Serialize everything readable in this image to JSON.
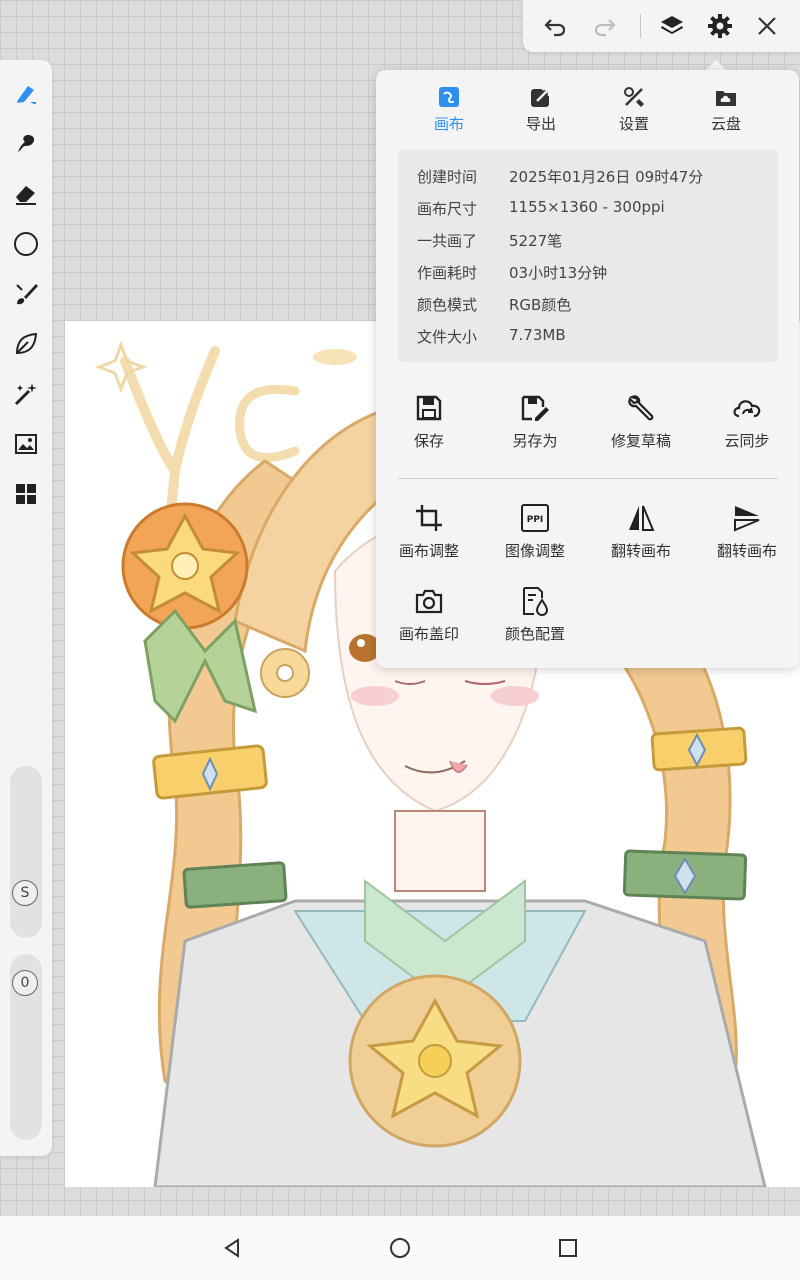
{
  "popup": {
    "tabs": [
      {
        "label": "画布",
        "icon": "canvas-icon",
        "active": true
      },
      {
        "label": "导出",
        "icon": "export-icon",
        "active": false
      },
      {
        "label": "设置",
        "icon": "settings-tools-icon",
        "active": false
      },
      {
        "label": "云盘",
        "icon": "cloud-drive-icon",
        "active": false
      }
    ],
    "info": [
      {
        "key": "创建时间",
        "value": "2025年01月26日 09时47分"
      },
      {
        "key": "画布尺寸",
        "value": "1155×1360 - 300ppi"
      },
      {
        "key": "一共画了",
        "value": "5227笔"
      },
      {
        "key": "作画耗时",
        "value": "03小时13分钟"
      },
      {
        "key": "颜色模式",
        "value": "RGB颜色"
      },
      {
        "key": "文件大小",
        "value": "7.73MB"
      }
    ],
    "actions_top": [
      {
        "label": "保存",
        "icon": "save-icon"
      },
      {
        "label": "另存为",
        "icon": "save-as-icon"
      },
      {
        "label": "修复草稿",
        "icon": "repair-wrench-icon"
      },
      {
        "label": "云同步",
        "icon": "cloud-sync-icon"
      }
    ],
    "actions_bottom": [
      {
        "label": "画布调整",
        "icon": "crop-icon"
      },
      {
        "label": "图像调整",
        "icon": "ppi-icon"
      },
      {
        "label": "翻转画布",
        "icon": "flip-horizontal-icon"
      },
      {
        "label": "翻转画布",
        "icon": "flip-vertical-icon"
      },
      {
        "label": "画布盖印",
        "icon": "camera-stamp-icon"
      },
      {
        "label": "颜色配置",
        "icon": "color-profile-icon"
      }
    ],
    "ppi_glyph": "PPI"
  },
  "sidebar": {
    "size_knob": "S",
    "opacity_knob": "0"
  },
  "colors": {
    "accent": "#2f8ff0",
    "panel": "#f4f4f4",
    "info_bg": "#e9e9e9"
  }
}
